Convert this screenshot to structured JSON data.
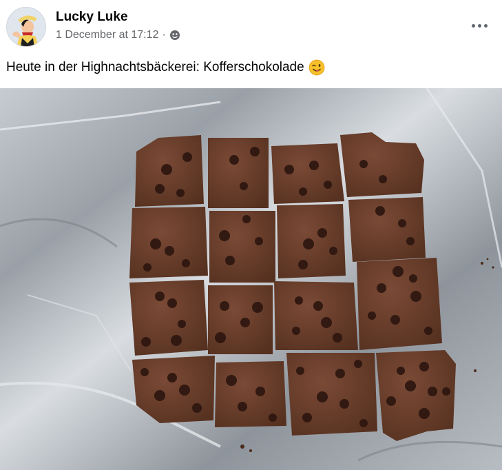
{
  "post": {
    "author": "Lucky Luke",
    "timestamp": "1 December at 17:12",
    "separator": "·",
    "audience_icon": "public-globe-icon",
    "text": "Heute in der Highnachtsbäckerei: Kofferschokolade",
    "emoji": "winking-face-emoji",
    "more_icon": "more-options-icon"
  },
  "photo": {
    "subject": "chocolate-squares-on-foil"
  }
}
